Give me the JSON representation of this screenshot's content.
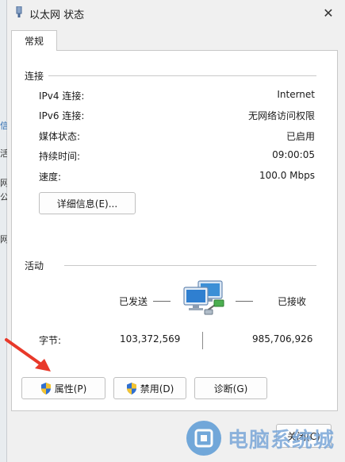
{
  "window": {
    "title": "以太网 状态",
    "close_glyph": "✕"
  },
  "tab": {
    "label": "常规"
  },
  "connection": {
    "section_title": "连接",
    "rows": [
      {
        "label": "IPv4 连接:",
        "value": "Internet"
      },
      {
        "label": "IPv6 连接:",
        "value": "无网络访问权限"
      },
      {
        "label": "媒体状态:",
        "value": "已启用"
      },
      {
        "label": "持续时间:",
        "value": "09:00:05"
      },
      {
        "label": "速度:",
        "value": "100.0 Mbps"
      }
    ],
    "details_button": "详细信息(E)..."
  },
  "activity": {
    "section_title": "活动",
    "sent_label": "已发送",
    "received_label": "已接收",
    "bytes_label": "字节:",
    "bytes_sent": "103,372,569",
    "bytes_received": "985,706,926"
  },
  "buttons": {
    "properties": "属性(P)",
    "disable": "禁用(D)",
    "diagnose": "诊断(G)",
    "close": "关闭(C)"
  },
  "watermark": {
    "text": "电脑系统城"
  },
  "colors": {
    "arrow": "#e8392a",
    "shield_blue": "#2f6fd0",
    "shield_yellow": "#f4c430",
    "network_icon": "#3b8fd6"
  }
}
